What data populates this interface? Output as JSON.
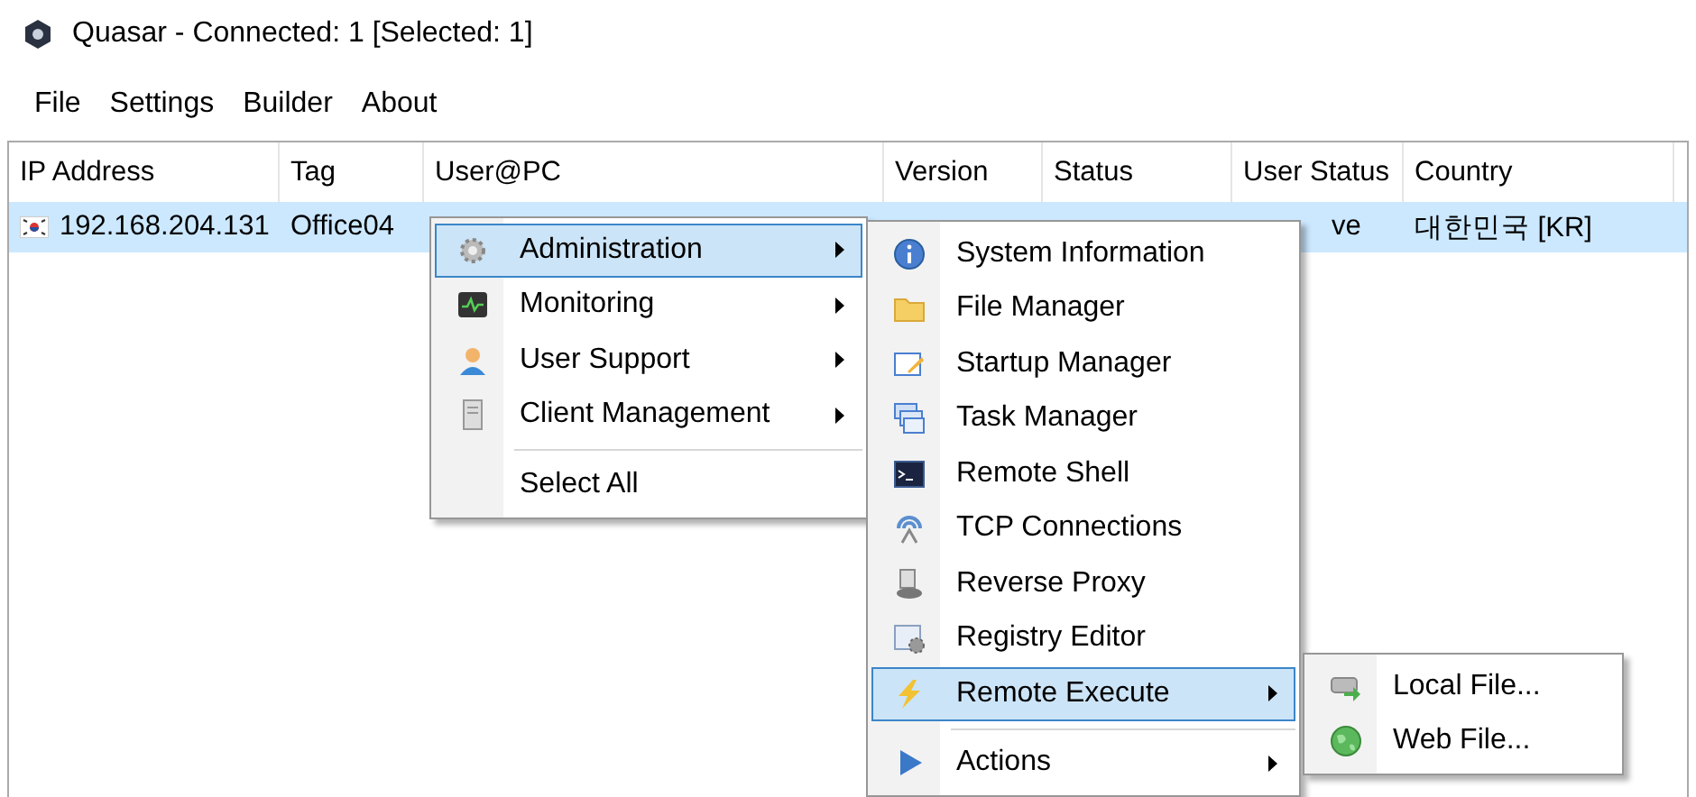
{
  "window": {
    "title": "Quasar - Connected: 1 [Selected: 1]"
  },
  "menu_bar": [
    "File",
    "Settings",
    "Builder",
    "About"
  ],
  "table": {
    "columns": [
      "IP Address",
      "Tag",
      "User@PC",
      "Version",
      "Status",
      "User Status",
      "Country"
    ],
    "rows": [
      {
        "selected": true,
        "ip_address": "192.168.204.131",
        "tag": "Office04",
        "user_status": "ve",
        "country": "대한민국 [KR]"
      }
    ]
  },
  "context_menu": {
    "items": [
      {
        "kind": "item",
        "label": "Administration",
        "has_submenu": true,
        "selected": true
      },
      {
        "kind": "item",
        "label": "Monitoring",
        "has_submenu": true,
        "selected": false
      },
      {
        "kind": "item",
        "label": "User Support",
        "has_submenu": true,
        "selected": false
      },
      {
        "kind": "item",
        "label": "Client Management",
        "has_submenu": true,
        "selected": false
      },
      {
        "kind": "separator"
      },
      {
        "kind": "item",
        "label": "Select All",
        "has_submenu": false,
        "selected": false
      }
    ]
  },
  "administration_submenu": {
    "items": [
      {
        "kind": "item",
        "label": "System Information",
        "has_submenu": false,
        "selected": false
      },
      {
        "kind": "item",
        "label": "File Manager",
        "has_submenu": false,
        "selected": false
      },
      {
        "kind": "item",
        "label": "Startup Manager",
        "has_submenu": false,
        "selected": false
      },
      {
        "kind": "item",
        "label": "Task Manager",
        "has_submenu": false,
        "selected": false
      },
      {
        "kind": "item",
        "label": "Remote Shell",
        "has_submenu": false,
        "selected": false
      },
      {
        "kind": "item",
        "label": "TCP Connections",
        "has_submenu": false,
        "selected": false
      },
      {
        "kind": "item",
        "label": "Reverse Proxy",
        "has_submenu": false,
        "selected": false
      },
      {
        "kind": "item",
        "label": "Registry Editor",
        "has_submenu": false,
        "selected": false
      },
      {
        "kind": "item",
        "label": "Remote Execute",
        "has_submenu": true,
        "selected": true
      },
      {
        "kind": "separator"
      },
      {
        "kind": "item",
        "label": "Actions",
        "has_submenu": true,
        "selected": false
      }
    ]
  },
  "remote_execute_submenu": {
    "items": [
      {
        "kind": "item",
        "label": "Local File...",
        "has_submenu": false,
        "selected": false
      },
      {
        "kind": "item",
        "label": "Web File...",
        "has_submenu": false,
        "selected": false
      }
    ]
  }
}
